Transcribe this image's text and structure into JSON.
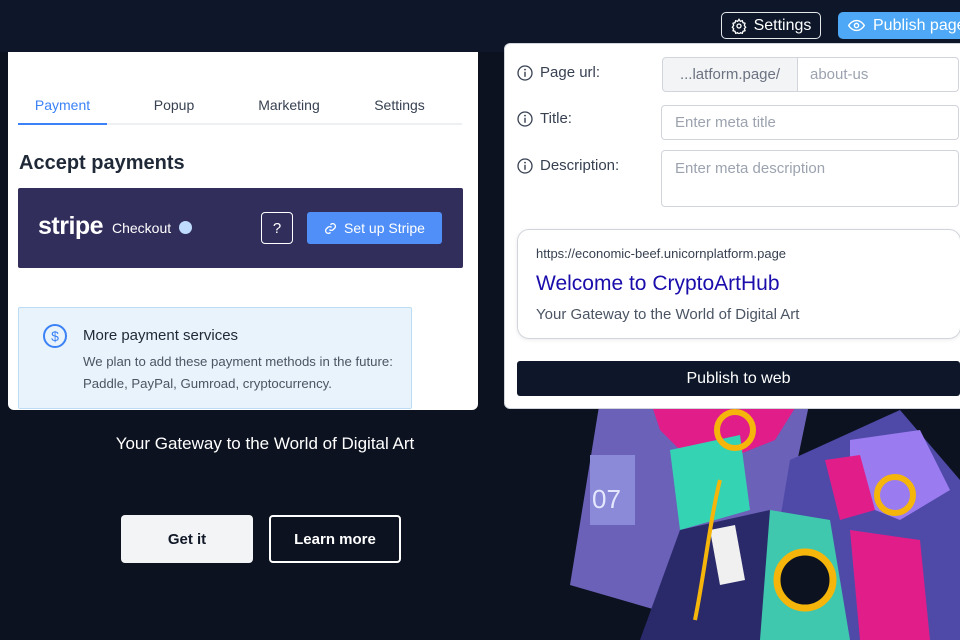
{
  "topbar": {
    "settings_label": "Settings",
    "publish_label": "Publish page"
  },
  "background": {
    "subtitle": "Your Gateway to the World of Digital Art",
    "get_it_label": "Get it",
    "learn_more_label": "Learn more",
    "artwork_number": "07"
  },
  "left_panel": {
    "tabs": [
      {
        "label": "Payment",
        "active": true
      },
      {
        "label": "Popup",
        "active": false
      },
      {
        "label": "Marketing",
        "active": false
      },
      {
        "label": "Settings",
        "active": false
      }
    ],
    "heading": "Accept payments",
    "stripe": {
      "logo": "stripe",
      "checkout_label": "Checkout",
      "help_label": "?",
      "setup_label": "Set up Stripe"
    },
    "more_services": {
      "title": "More payment services",
      "description": "We plan to add these payment methods in the future: Paddle, PayPal, Gumroad, cryptocurrency."
    }
  },
  "right_panel": {
    "page_url_label": "Page url:",
    "url_prefix": "...latform.page/",
    "url_slug_placeholder": "about-us",
    "title_label": "Title:",
    "title_placeholder": "Enter meta title",
    "description_label": "Description:",
    "description_placeholder": "Enter meta description",
    "preview": {
      "url": "https://economic-beef.unicornplatform.page",
      "title": "Welcome to CryptoArtHub",
      "description": "Your Gateway to the World of Digital Art"
    },
    "publish_label": "Publish to web"
  },
  "colors": {
    "accent_blue": "#3b82f6",
    "publish_blue": "#4ea8f5",
    "stripe_bg": "#322e5c",
    "dark_navy": "#0d1729",
    "serp_link": "#1a0dab"
  }
}
